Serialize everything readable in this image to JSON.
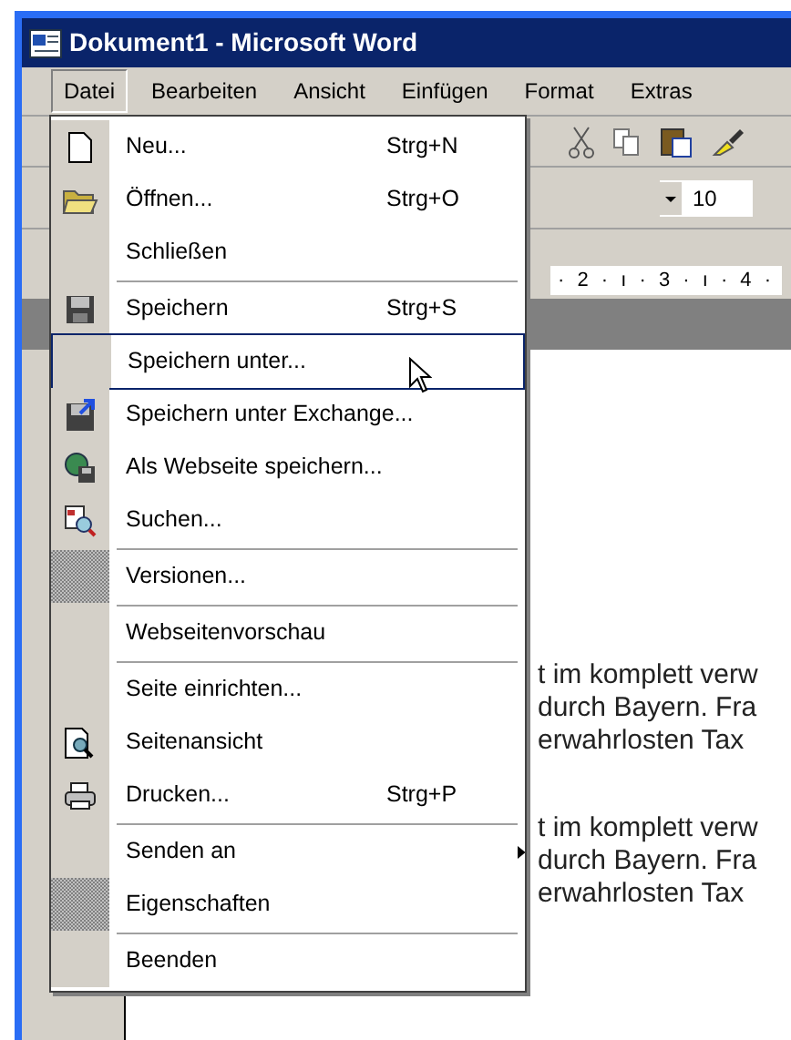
{
  "window": {
    "title": "Dokument1 - Microsoft Word"
  },
  "menubar": [
    {
      "label": "Datei",
      "selected": true
    },
    {
      "label": "Bearbeiten",
      "selected": false
    },
    {
      "label": "Ansicht",
      "selected": false
    },
    {
      "label": "Einfügen",
      "selected": false
    },
    {
      "label": "Format",
      "selected": false
    },
    {
      "label": "Extras",
      "selected": false
    }
  ],
  "font_size": {
    "value": "10"
  },
  "ruler": "· 2 · ı · 3 · ı · 4 ·",
  "document": {
    "paragraphs": [
      [
        "t im komplett verw",
        "durch Bayern. Fra",
        "erwahrlosten Tax"
      ],
      [
        "t im komplett verw",
        "durch Bayern. Fra",
        "erwahrlosten Tax"
      ]
    ]
  },
  "menu": [
    {
      "kind": "new",
      "label": "Neu...",
      "shortcut": "Strg+N",
      "selected": false
    },
    {
      "kind": "open",
      "label": "Öffnen...",
      "shortcut": "Strg+O",
      "selected": false
    },
    {
      "kind": "plain",
      "label": "Schließen",
      "selected": false
    },
    {
      "kind": "separator"
    },
    {
      "kind": "save",
      "label": "Speichern",
      "shortcut": "Strg+S",
      "selected": false
    },
    {
      "kind": "plain",
      "label": "Speichern unter...",
      "selected": true
    },
    {
      "kind": "save-exchange",
      "label": "Speichern unter Exchange...",
      "selected": false
    },
    {
      "kind": "web-save",
      "label": "Als Webseite speichern...",
      "selected": false
    },
    {
      "kind": "search",
      "label": "Suchen...",
      "selected": false
    },
    {
      "kind": "separator"
    },
    {
      "kind": "hatched",
      "label": "Versionen...",
      "selected": false
    },
    {
      "kind": "separator"
    },
    {
      "kind": "plain",
      "label": "Webseitenvorschau",
      "selected": false
    },
    {
      "kind": "separator"
    },
    {
      "kind": "plain",
      "label": "Seite einrichten...",
      "selected": false
    },
    {
      "kind": "preview",
      "label": "Seitenansicht",
      "selected": false
    },
    {
      "kind": "print",
      "label": "Drucken...",
      "shortcut": "Strg+P",
      "selected": false
    },
    {
      "kind": "separator"
    },
    {
      "kind": "submenu",
      "label": "Senden an",
      "selected": false
    },
    {
      "kind": "hatched",
      "label": "Eigenschaften",
      "selected": false
    },
    {
      "kind": "separator"
    },
    {
      "kind": "plain",
      "label": "Beenden",
      "selected": false
    }
  ]
}
